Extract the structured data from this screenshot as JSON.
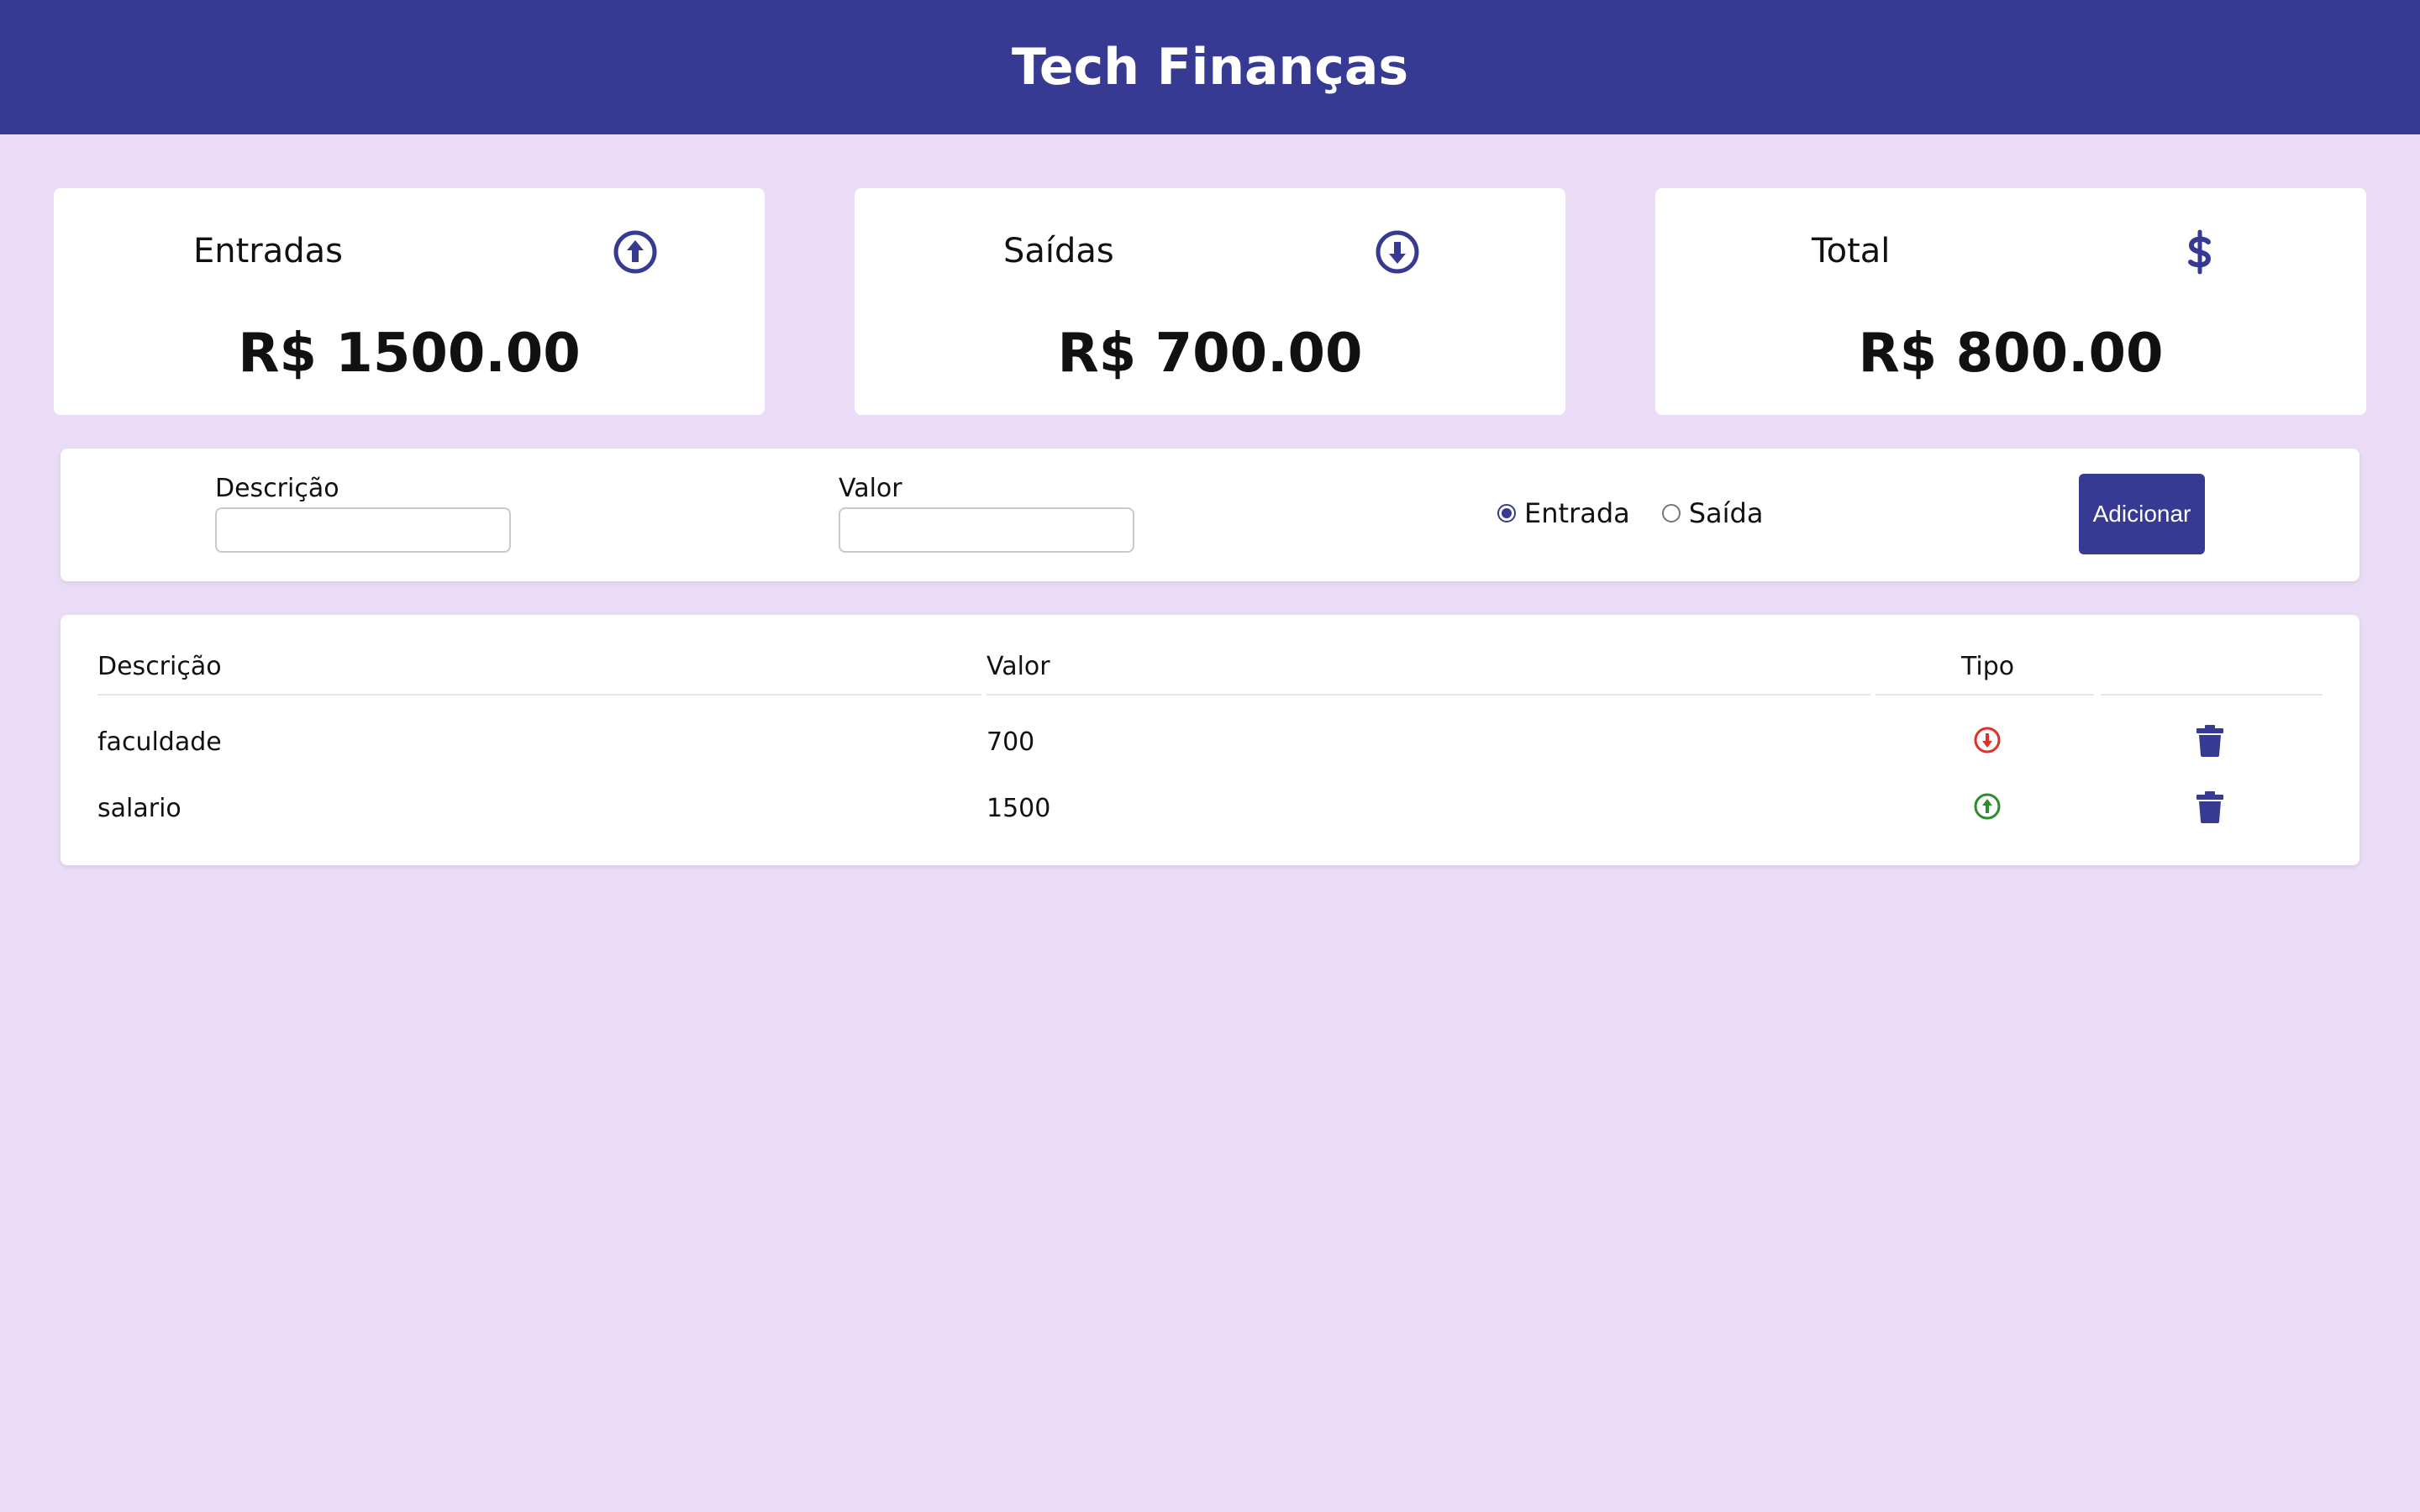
{
  "header": {
    "title": "Tech Finanças"
  },
  "summary": {
    "entradas": {
      "label": "Entradas",
      "value": "R$ 1500.00",
      "icon": "arrow-up-circle-icon"
    },
    "saidas": {
      "label": "Saídas",
      "value": "R$ 700.00",
      "icon": "arrow-down-circle-icon"
    },
    "total": {
      "label": "Total",
      "value": "R$ 800.00",
      "icon": "dollar-icon"
    }
  },
  "form": {
    "descricao_label": "Descrição",
    "descricao_value": "",
    "valor_label": "Valor",
    "valor_value": "",
    "type_options": [
      "Entrada",
      "Saída"
    ],
    "type_selected": "Entrada",
    "add_button": "Adicionar"
  },
  "table": {
    "headers": [
      "Descrição",
      "Valor",
      "Tipo",
      ""
    ],
    "rows": [
      {
        "descricao": "faculdade",
        "valor": "700",
        "tipo": "saida"
      },
      {
        "descricao": "salario",
        "valor": "1500",
        "tipo": "entrada"
      }
    ]
  },
  "colors": {
    "primary": "#373a92",
    "background": "#eadbf6",
    "entrada": "#2e8b2e",
    "saida": "#e0302a"
  }
}
